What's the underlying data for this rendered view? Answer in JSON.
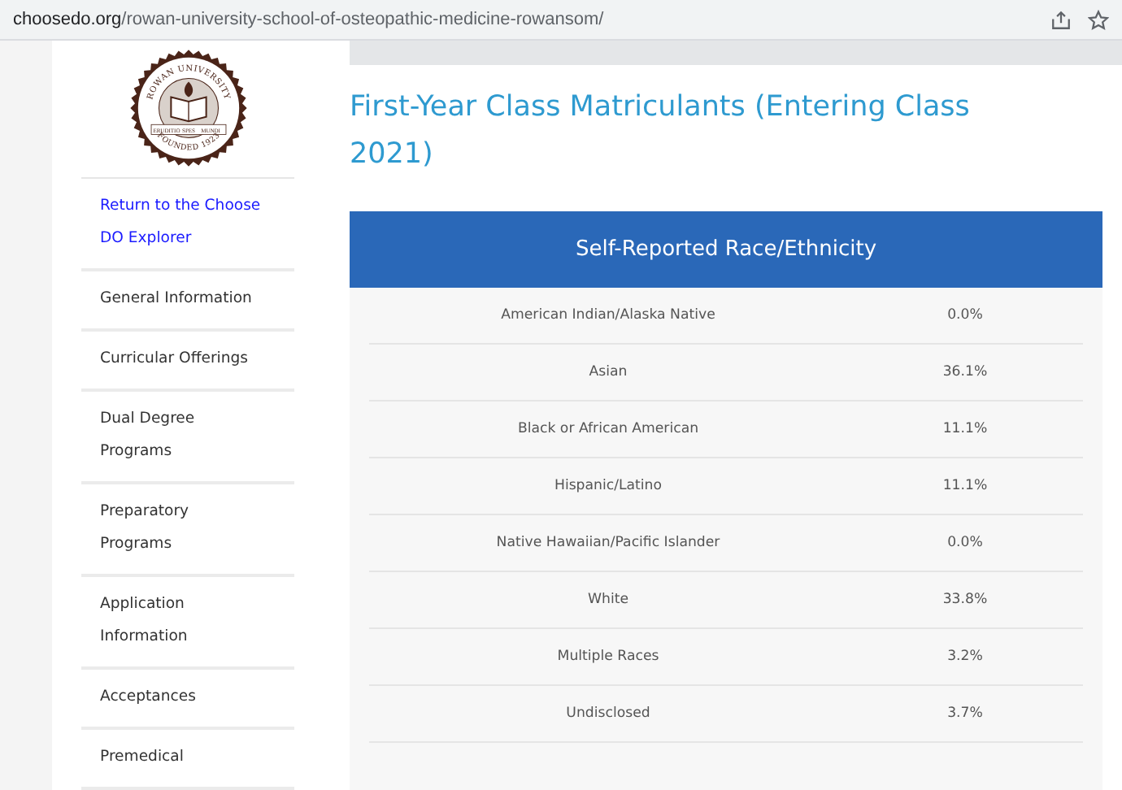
{
  "address_bar": {
    "host": "choosedo.org",
    "path": "/rowan-university-school-of-osteopathic-medicine-rowansom/"
  },
  "logo": {
    "top_text": "ROWAN UNIVERSITY",
    "bottom_text": "FOUNDED 1923",
    "motto": [
      "ERUDITIO",
      "SPES",
      "MUNDI"
    ]
  },
  "sidebar": {
    "items": [
      {
        "label": "Return to the Choose DO Explorer",
        "kind": "link"
      },
      {
        "label": "General Information",
        "kind": "item"
      },
      {
        "label": "Curricular Offerings",
        "kind": "item"
      },
      {
        "label": "Dual Degree Programs",
        "kind": "item"
      },
      {
        "label": "Preparatory Programs",
        "kind": "item"
      },
      {
        "label": "Application Information",
        "kind": "item"
      },
      {
        "label": "Acceptances",
        "kind": "item"
      },
      {
        "label": "Premedical",
        "kind": "item"
      }
    ]
  },
  "page_title": "First-Year Class Matriculants (Entering Class 2021)",
  "table": {
    "title": "Self-Reported Race/Ethnicity",
    "rows": [
      {
        "label": "American Indian/Alaska Native",
        "value": "0.0%"
      },
      {
        "label": "Asian",
        "value": "36.1%"
      },
      {
        "label": "Black or African American",
        "value": "11.1%"
      },
      {
        "label": "Hispanic/Latino",
        "value": "11.1%"
      },
      {
        "label": "Native Hawaiian/Pacific Islander",
        "value": "0.0%"
      },
      {
        "label": "White",
        "value": "33.8%"
      },
      {
        "label": "Multiple Races",
        "value": "3.2%"
      },
      {
        "label": "Undisclosed",
        "value": "3.7%"
      }
    ]
  }
}
